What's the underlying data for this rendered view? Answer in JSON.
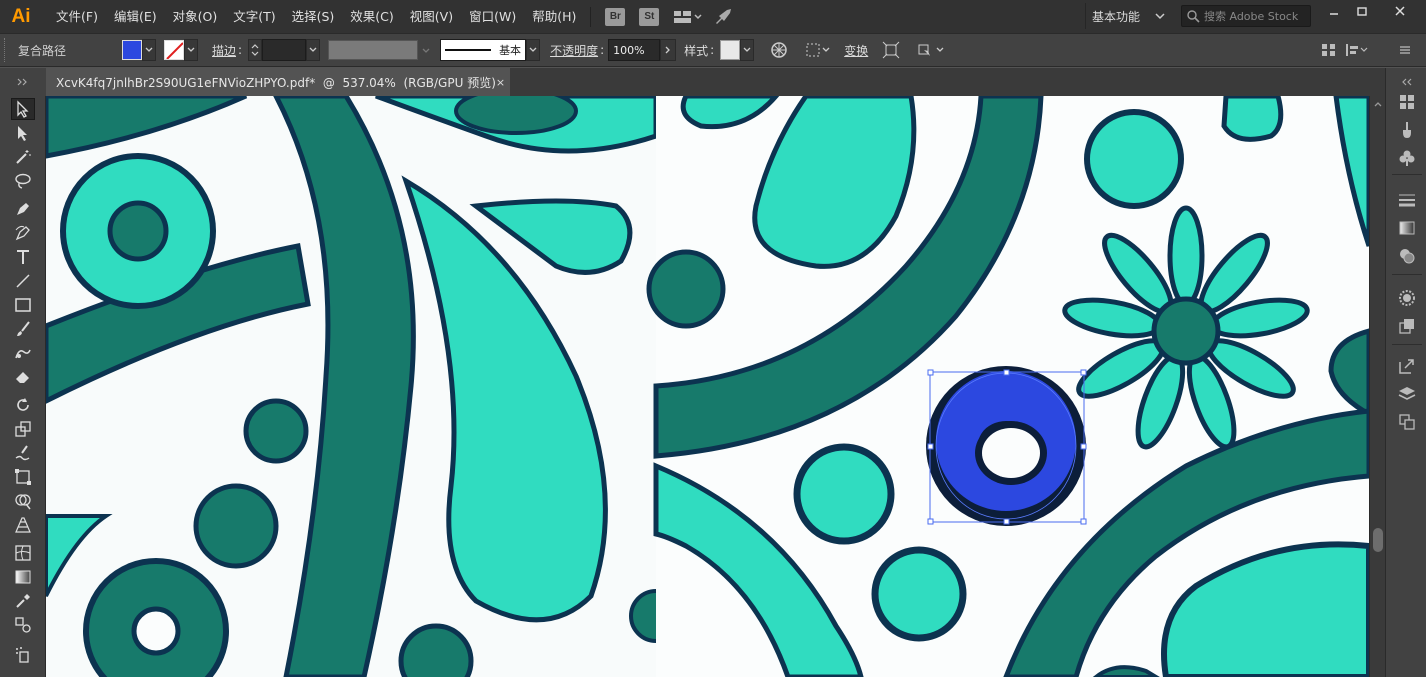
{
  "app": {
    "logo": "Ai",
    "accent": "#ff9a00"
  },
  "menu": [
    "文件(F)",
    "编辑(E)",
    "对象(O)",
    "文字(T)",
    "选择(S)",
    "效果(C)",
    "视图(V)",
    "窗口(W)",
    "帮助(H)"
  ],
  "menubar_icons": {
    "bridge": "Br",
    "stock": "St"
  },
  "workspace": {
    "label": "基本功能"
  },
  "search": {
    "placeholder": "搜索 Adobe Stock"
  },
  "window_controls": [
    "minimize-icon",
    "restore-icon",
    "close-icon"
  ],
  "control_bar": {
    "object_type": "复合路径",
    "fill_color": "#2c48e0",
    "stroke_label": "描边",
    "stroke_style_label": "基本",
    "opacity_label": "不透明度",
    "opacity_value": "100%",
    "style_label": "样式",
    "transform_label": "变换"
  },
  "document": {
    "tab_title": "XcvK4fq7jnlhBr2S90UG1eFNVioZHPYO.pdf*  @  537.04%  (RGB/GPU 预览)",
    "close": "×"
  },
  "tools": [
    "selection-tool",
    "direct-selection-tool",
    "magic-wand-tool",
    "lasso-tool",
    "pen-tool",
    "curvature-tool",
    "type-tool",
    "line-tool",
    "rectangle-tool",
    "paintbrush-tool",
    "shaper-tool",
    "eraser-tool",
    "rotate-tool",
    "scale-tool",
    "warp-tool",
    "free-transform-tool",
    "shape-builder-tool",
    "perspective-grid-tool",
    "mesh-tool",
    "gradient-tool",
    "eyedropper-tool",
    "blend-tool",
    "symbol-sprayer-tool"
  ],
  "right_panel": [
    "libraries-icon",
    "brushes-icon",
    "symbols-icon",
    "stroke-panel-icon",
    "gradient-panel-icon",
    "transparency-icon",
    "appearance-icon",
    "graphic-styles-icon",
    "export-icon",
    "layers-icon",
    "artboards-icon"
  ],
  "artwork": {
    "dark_teal": "#177a6b",
    "light_teal": "#30dcc0",
    "outline": "#0c3350",
    "selected_fill": "#2c48e0"
  }
}
